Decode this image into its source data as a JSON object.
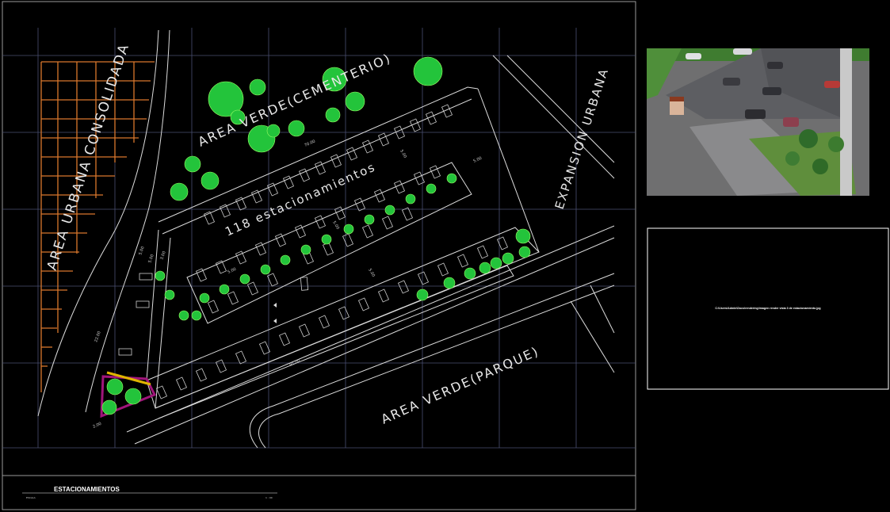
{
  "labels": {
    "urban_consolidated": "AREA URBANA CONSOLIDADA",
    "green_cemetery": "AREA VERDE(CEMENTERIO)",
    "parking_count": "118 estacionamientos",
    "urban_expansion": "EXPANSION URBANA",
    "green_park": "AREA VERDE(PARQUE)"
  },
  "dimensions": [
    "70.00",
    "5.00",
    "5.00",
    "5.00",
    "5.00",
    "5.00",
    "5.00",
    "5.00",
    "3.00",
    "22.00",
    "91.00",
    "2.00"
  ],
  "title_block": {
    "title": "ESTACIONAMIENTOS",
    "small_left": "ESCALA",
    "small_right": "1 : 00"
  },
  "image_panel": {
    "caption": "C:\\Users\\Admin\\Docs\\rendering\\imagen render vista 3 de estacionamiento.jpg"
  },
  "colors": {
    "background": "#000000",
    "line": "#dcdcdc",
    "grid": "#4a4f72",
    "orange_grid": "#d9772c",
    "tree_green": "#23c43b",
    "magenta": "#a0157a",
    "yellow": "#e0b400"
  }
}
